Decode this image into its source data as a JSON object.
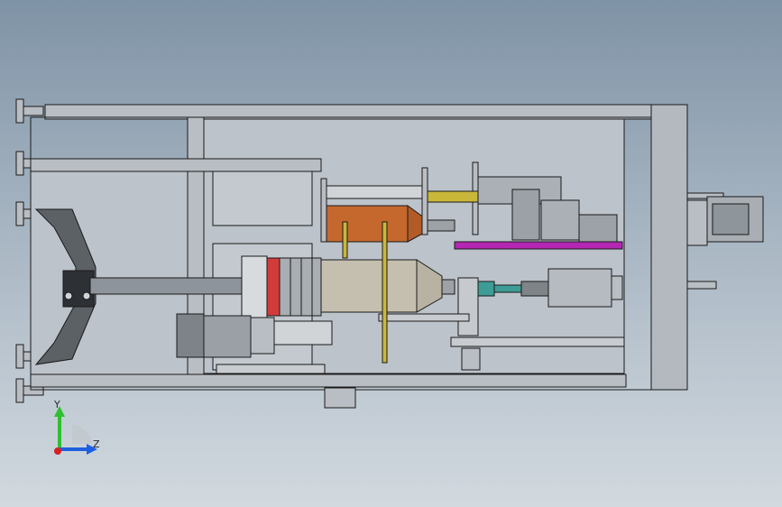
{
  "viewport": {
    "background_top": "#7f93a6",
    "background_bottom": "#d2d9df"
  },
  "triad": {
    "y_label": "Y",
    "z_label": "Z",
    "y_color": "#2fbf2f",
    "z_color": "#1f5fe0",
    "x_color": "#d42020"
  },
  "model": {
    "frame_color": "#b9bec4",
    "edge_color": "#1a1a1a",
    "highlight_orange": "#c4682e",
    "highlight_magenta": "#b327b3",
    "highlight_red": "#d23b3b",
    "highlight_teal": "#3d9d96",
    "highlight_yellow": "#c9b73a"
  }
}
